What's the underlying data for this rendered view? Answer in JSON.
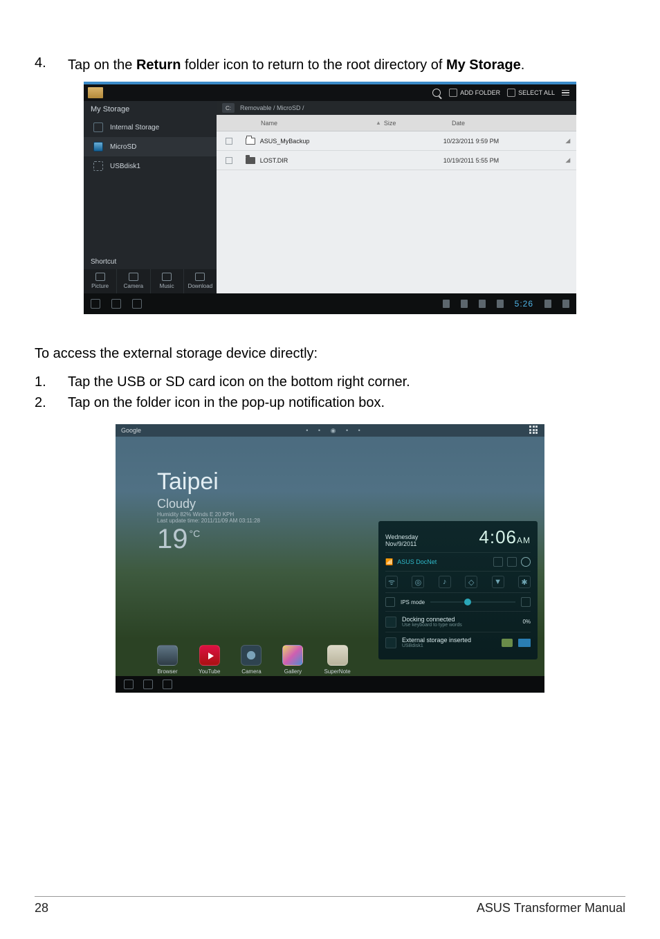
{
  "instruction4": {
    "num": "4.",
    "pre": "Tap on the ",
    "b1": "Return",
    "mid": " folder icon to return to the root directory of ",
    "b2": "My Storage",
    "post": "."
  },
  "ss1": {
    "topbar": {
      "search": "",
      "addFolder": "ADD FOLDER",
      "selectAll": "SELECT ALL"
    },
    "side": {
      "header": "My Storage",
      "items": [
        {
          "label": "Internal Storage"
        },
        {
          "label": "MicroSD"
        },
        {
          "label": "USBdisk1"
        }
      ],
      "shortcutTitle": "Shortcut",
      "shortcuts": [
        {
          "label": "Picture"
        },
        {
          "label": "Camera"
        },
        {
          "label": "Music"
        },
        {
          "label": "Download"
        }
      ]
    },
    "crumb": {
      "icon": "C:",
      "path": "Removable / MicroSD /"
    },
    "cols": {
      "name": "Name",
      "size": "Size",
      "date": "Date",
      "sort": "▲"
    },
    "rows": [
      {
        "name": "ASUS_MyBackup",
        "size": "",
        "date": "10/23/2011 9:59 PM"
      },
      {
        "name": "LOST.DIR",
        "size": "",
        "date": "10/19/2011 5:55 PM"
      }
    ],
    "navbar": {
      "time": "5:26"
    }
  },
  "heading": "To access the external storage device directly:",
  "list": [
    {
      "n": "1.",
      "t": "Tap the USB or SD card icon on the bottom right corner."
    },
    {
      "n": "2.",
      "t": "Tap on the folder icon in the pop-up notification box."
    }
  ],
  "ss2": {
    "google": "Google",
    "weather": {
      "city": "Taipei",
      "cond": "Cloudy",
      "sub1": "Humidity 82%  Winds E 20 KPH",
      "sub2": "Last update time: 2011/11/09 AM 03:11:28",
      "temp": "19",
      "unit": "°C"
    },
    "panel": {
      "day": "Wednesday",
      "date": "Nov/9/2011",
      "time": "4:06",
      "ampm": "AM",
      "wifi": "ASUS DocNet",
      "ips": "IPS mode",
      "dock": {
        "t1": "Docking connected",
        "t2": "Use keyboard to type words",
        "pct": "0%"
      },
      "ext": {
        "t1": "External storage inserted",
        "t2": "USBdisk1"
      }
    },
    "dock": [
      {
        "label": "Browser",
        "cls": ""
      },
      {
        "label": "YouTube",
        "cls": "yt"
      },
      {
        "label": "Camera",
        "cls": "cam"
      },
      {
        "label": "Gallery",
        "cls": "gal"
      },
      {
        "label": "SuperNote",
        "cls": "note"
      }
    ]
  },
  "footer": {
    "page": "28",
    "title": "ASUS Transformer Manual"
  }
}
